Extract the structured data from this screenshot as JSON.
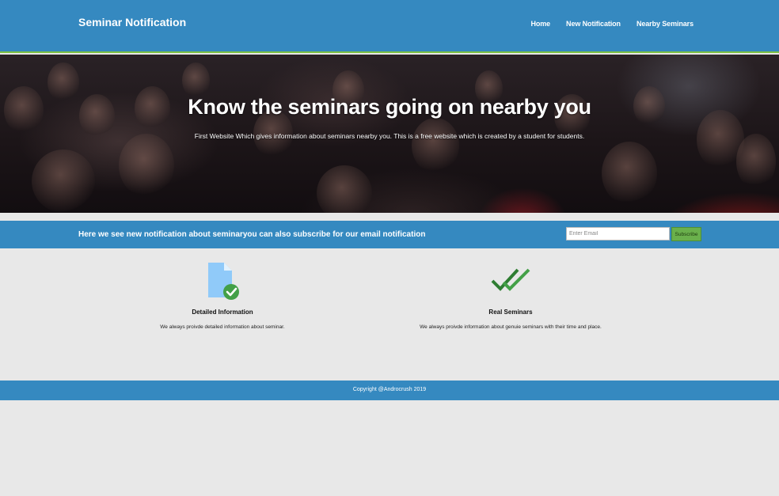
{
  "header": {
    "brand": "Seminar Notification",
    "nav": [
      {
        "label": "Home"
      },
      {
        "label": "New Notification"
      },
      {
        "label": "Nearby Seminars"
      }
    ]
  },
  "hero": {
    "title": "Know the seminars going on nearby you",
    "subtitle": "First Website Which gives information about seminars nearby you. This is a free website which is created by a student for students."
  },
  "subscribe": {
    "text": "Here we see new notification about seminaryou can also subscribe for our email notification",
    "placeholder": "Enter Email",
    "button_label": "Subscribe"
  },
  "features": [
    {
      "icon": "document-check-icon",
      "title": "Detailed Information",
      "description": "We always proivde detailed information about seminar."
    },
    {
      "icon": "double-check-icon",
      "title": "Real Seminars",
      "description": "We always proivde information about genuie seminars with their time and place."
    }
  ],
  "footer": {
    "copyright": "Copyright @Androcrush 2019"
  },
  "colors": {
    "primary": "#3589c0",
    "accent_green": "#7bc043",
    "page_bg": "#e8e8e8"
  }
}
